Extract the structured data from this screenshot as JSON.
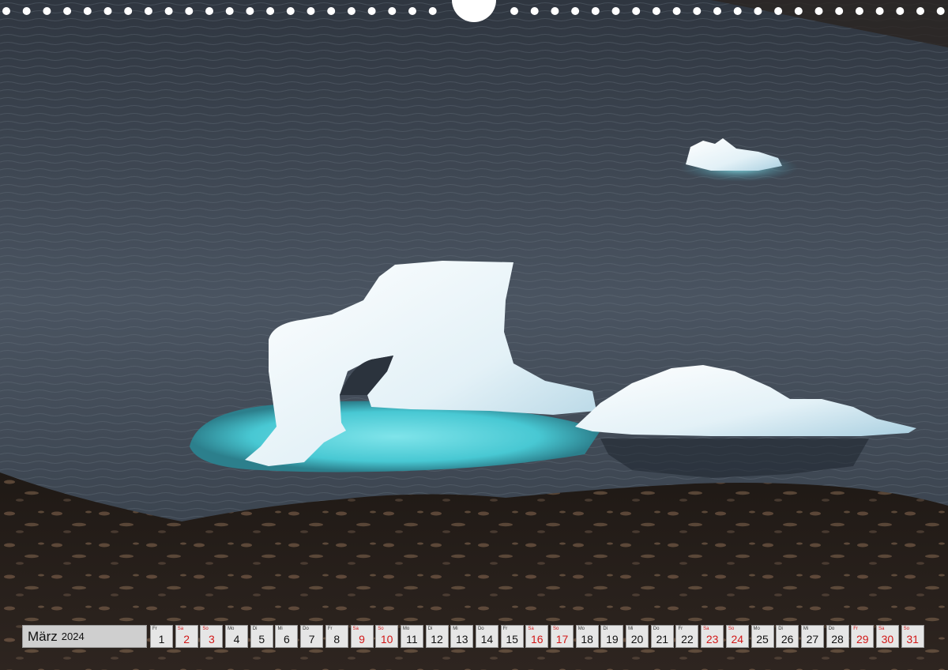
{
  "calendar": {
    "month": "März",
    "year": "2024",
    "days": [
      {
        "abbr": "Fr",
        "num": "1",
        "weekend": false
      },
      {
        "abbr": "Sa",
        "num": "2",
        "weekend": true
      },
      {
        "abbr": "So",
        "num": "3",
        "weekend": true
      },
      {
        "abbr": "Mo",
        "num": "4",
        "weekend": false
      },
      {
        "abbr": "Di",
        "num": "5",
        "weekend": false
      },
      {
        "abbr": "Mi",
        "num": "6",
        "weekend": false
      },
      {
        "abbr": "Do",
        "num": "7",
        "weekend": false
      },
      {
        "abbr": "Fr",
        "num": "8",
        "weekend": false
      },
      {
        "abbr": "Sa",
        "num": "9",
        "weekend": true
      },
      {
        "abbr": "So",
        "num": "10",
        "weekend": true
      },
      {
        "abbr": "Mo",
        "num": "11",
        "weekend": false
      },
      {
        "abbr": "Di",
        "num": "12",
        "weekend": false
      },
      {
        "abbr": "Mi",
        "num": "13",
        "weekend": false
      },
      {
        "abbr": "Do",
        "num": "14",
        "weekend": false
      },
      {
        "abbr": "Fr",
        "num": "15",
        "weekend": false
      },
      {
        "abbr": "Sa",
        "num": "16",
        "weekend": true
      },
      {
        "abbr": "So",
        "num": "17",
        "weekend": true
      },
      {
        "abbr": "Mo",
        "num": "18",
        "weekend": false
      },
      {
        "abbr": "Di",
        "num": "19",
        "weekend": false
      },
      {
        "abbr": "Mi",
        "num": "20",
        "weekend": false
      },
      {
        "abbr": "Do",
        "num": "21",
        "weekend": false
      },
      {
        "abbr": "Fr",
        "num": "22",
        "weekend": false
      },
      {
        "abbr": "Sa",
        "num": "23",
        "weekend": true
      },
      {
        "abbr": "So",
        "num": "24",
        "weekend": true
      },
      {
        "abbr": "Mo",
        "num": "25",
        "weekend": false
      },
      {
        "abbr": "Di",
        "num": "26",
        "weekend": false
      },
      {
        "abbr": "Mi",
        "num": "27",
        "weekend": false
      },
      {
        "abbr": "Do",
        "num": "28",
        "weekend": false
      },
      {
        "abbr": "Fr",
        "num": "29",
        "weekend": true
      },
      {
        "abbr": "Sa",
        "num": "30",
        "weekend": true
      },
      {
        "abbr": "So",
        "num": "31",
        "weekend": true
      }
    ]
  },
  "colors": {
    "weekend": "#d21818",
    "water": "#3d4652",
    "lagoon": "#5fd6df",
    "ice": "#eef6fa",
    "rock": "#2b211c"
  },
  "photo": {
    "subject": "iceberg-arch-photo"
  }
}
